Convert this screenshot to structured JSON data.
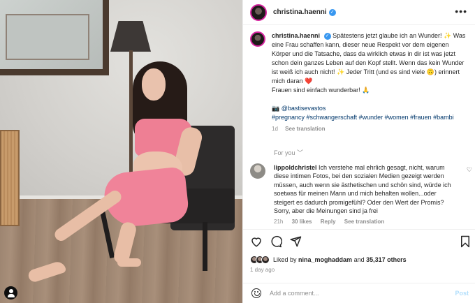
{
  "post": {
    "username": "christina.haenni",
    "more_icon": "more-horizontal-icon"
  },
  "caption": {
    "username": "christina.haenni",
    "text_1": "Spätestens jetzt glaube ich an Wunder! ✨ Was eine Frau schaffen kann, dieser neue Respekt vor dem eigenen Körper und die Tatsache, dass da wirklich etwas in dir ist was jetzt schon dein ganzes Leben auf den Kopf stellt. Wenn das kein Wunder ist weiß ich auch nicht! ✨ Jeder Tritt (und es sind viele 🙃) erinnert mich daran ❤️",
    "text_2": "Frauen sind einfach wunderbar! 🙏",
    "credit": "📷 @bastisevastos",
    "hashtags": "#pregnancy #schwangerschaft #wunder #women #frauen #bambi",
    "time": "1d",
    "see_translation": "See translation"
  },
  "for_you": "For you ﹀",
  "comment": {
    "username": "lippoldchristel",
    "text": "Ich verstehe mal ehrlich gesagt, nicht, warum diese intimen Fotos, bei den sozialen Medien gezeigt werden müssen, auch wenn sie ästhetischen und schön sind, würde ich soetwas für meinen Mann und mich behalten wollen...oder steigert es dadurch promigefühl? Oder den Wert der Promis? Sorry, aber die Meinungen sind ja frei",
    "time": "21h",
    "likes": "30 likes",
    "reply": "Reply",
    "see_translation": "See translation"
  },
  "actions": {
    "liked_by_prefix": "Liked by",
    "liked_by_user": "nina_moghaddam",
    "liked_by_and": "and",
    "liked_by_count": "35,317 others",
    "date": "1 day ago"
  },
  "add_comment": {
    "placeholder": "Add a comment...",
    "post_label": "Post"
  },
  "colors": {
    "accent": "#3897f0",
    "link": "#00376b",
    "muted": "#8e8e8e",
    "post_disabled": "#b2dffc"
  }
}
